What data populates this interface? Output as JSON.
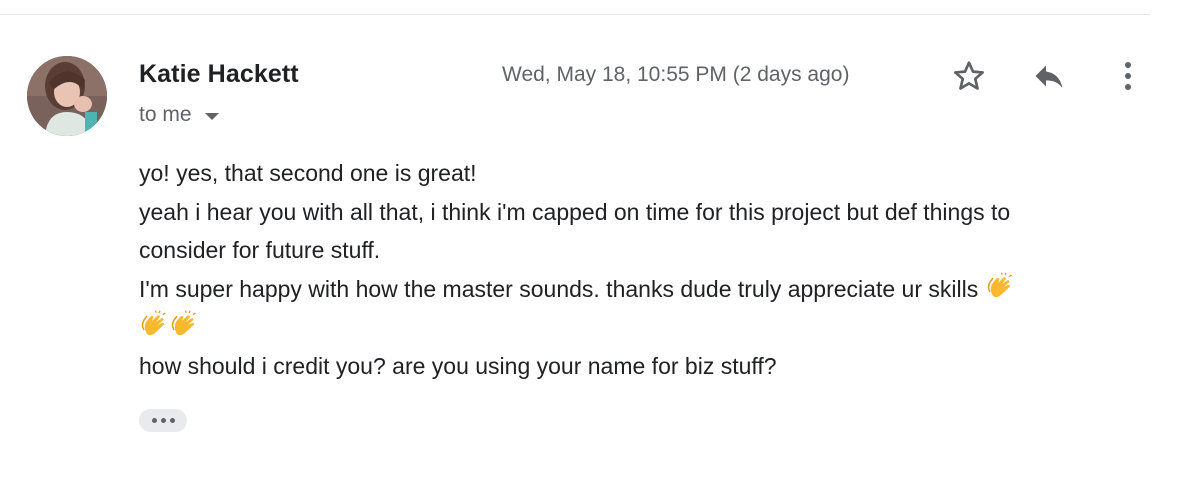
{
  "message": {
    "sender": "Katie Hackett",
    "recipient": "to me",
    "timestamp": "Wed, May 18, 10:55 PM (2 days ago)",
    "body_lines": [
      "yo! yes, that second one is great!",
      "yeah i hear you with all that, i think i'm capped on time for this project but def things to",
      "consider for future stuff.",
      "I'm super happy with how the master sounds. thanks dude truly appreciate ur skills",
      "how should i credit you? are you using your name for biz stuff?"
    ]
  },
  "icons": {
    "avatar": "avatar-photo",
    "caret": "caret-down-icon",
    "star": "star-outline-icon",
    "reply": "reply-arrow-icon",
    "more": "more-vertical-icon",
    "clap": "clapping-hands-emoji",
    "trimmed": "show-trimmed-content-icon"
  },
  "colors": {
    "text_primary": "#202124",
    "text_secondary": "#5f6368",
    "pill_bg": "#e8eaed",
    "emoji": "#f8b92e"
  }
}
